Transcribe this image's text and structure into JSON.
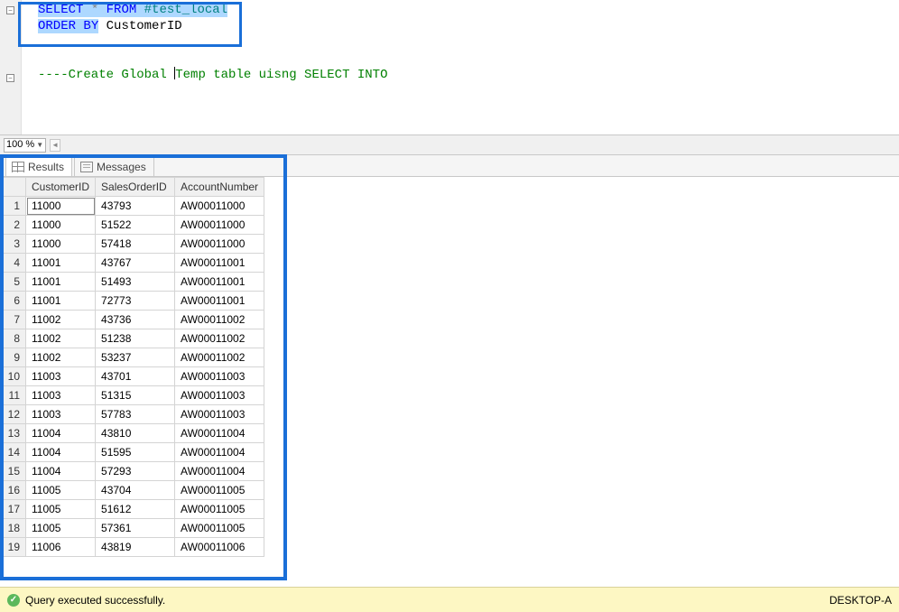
{
  "editor": {
    "line1_select": "SELECT",
    "line1_star": " * ",
    "line1_from": "FROM",
    "line1_temp": " #test_local",
    "line2_order": "ORDER",
    "line2_by": " BY",
    "line2_col": " CustomerID",
    "comment_pre": "----Create Global ",
    "comment_post": "Temp table uisng SELECT INTO"
  },
  "zoom": {
    "value": "100 %"
  },
  "tabs": {
    "results": "Results",
    "messages": "Messages"
  },
  "grid": {
    "headers": {
      "c1": "CustomerID",
      "c2": "SalesOrderID",
      "c3": "AccountNumber"
    },
    "rows": [
      {
        "n": "1",
        "c1": "11000",
        "c2": "43793",
        "c3": "AW00011000"
      },
      {
        "n": "2",
        "c1": "11000",
        "c2": "51522",
        "c3": "AW00011000"
      },
      {
        "n": "3",
        "c1": "11000",
        "c2": "57418",
        "c3": "AW00011000"
      },
      {
        "n": "4",
        "c1": "11001",
        "c2": "43767",
        "c3": "AW00011001"
      },
      {
        "n": "5",
        "c1": "11001",
        "c2": "51493",
        "c3": "AW00011001"
      },
      {
        "n": "6",
        "c1": "11001",
        "c2": "72773",
        "c3": "AW00011001"
      },
      {
        "n": "7",
        "c1": "11002",
        "c2": "43736",
        "c3": "AW00011002"
      },
      {
        "n": "8",
        "c1": "11002",
        "c2": "51238",
        "c3": "AW00011002"
      },
      {
        "n": "9",
        "c1": "11002",
        "c2": "53237",
        "c3": "AW00011002"
      },
      {
        "n": "10",
        "c1": "11003",
        "c2": "43701",
        "c3": "AW00011003"
      },
      {
        "n": "11",
        "c1": "11003",
        "c2": "51315",
        "c3": "AW00011003"
      },
      {
        "n": "12",
        "c1": "11003",
        "c2": "57783",
        "c3": "AW00011003"
      },
      {
        "n": "13",
        "c1": "11004",
        "c2": "43810",
        "c3": "AW00011004"
      },
      {
        "n": "14",
        "c1": "11004",
        "c2": "51595",
        "c3": "AW00011004"
      },
      {
        "n": "15",
        "c1": "11004",
        "c2": "57293",
        "c3": "AW00011004"
      },
      {
        "n": "16",
        "c1": "11005",
        "c2": "43704",
        "c3": "AW00011005"
      },
      {
        "n": "17",
        "c1": "11005",
        "c2": "51612",
        "c3": "AW00011005"
      },
      {
        "n": "18",
        "c1": "11005",
        "c2": "57361",
        "c3": "AW00011005"
      },
      {
        "n": "19",
        "c1": "11006",
        "c2": "43819",
        "c3": "AW00011006"
      }
    ]
  },
  "status": {
    "message": "Query executed successfully.",
    "server": "DESKTOP-A"
  }
}
